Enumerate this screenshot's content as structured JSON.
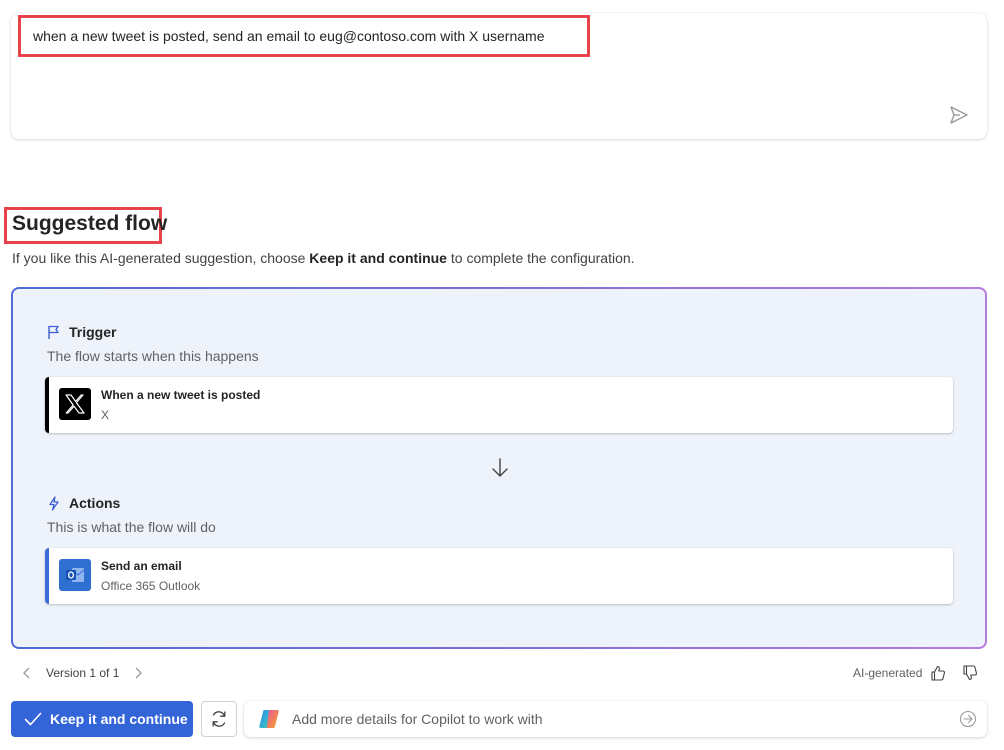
{
  "prompt": {
    "text": "when a new tweet is posted, send an email to eug@contoso.com with X username"
  },
  "header": {
    "title": "Suggested flow",
    "subtitle_pre": "If you like this AI-generated suggestion, choose ",
    "subtitle_bold": "Keep it and continue",
    "subtitle_post": " to complete the configuration."
  },
  "flow": {
    "trigger": {
      "title": "Trigger",
      "description": "The flow starts when this happens",
      "step": {
        "title": "When a new tweet is posted",
        "connector": "X",
        "accent": "#000000"
      }
    },
    "actions": {
      "title": "Actions",
      "description": "This is what the flow will do",
      "step": {
        "title": "Send an email",
        "connector": "Office 365 Outlook",
        "accent": "#3b6fd4"
      }
    }
  },
  "footer": {
    "version": "Version 1 of 1",
    "ai_generated": "AI-generated"
  },
  "actions_bar": {
    "keep_label": "Keep it and continue",
    "input_placeholder": "Add more details for Copilot to work with"
  },
  "colors": {
    "primary": "#3364d8",
    "highlight": "#e8434a",
    "flow_bg": "#eef3fb"
  },
  "icons": [
    "send-icon",
    "flag-icon",
    "x-logo-icon",
    "arrow-down-icon",
    "lightning-icon",
    "outlook-icon",
    "chevron-left-icon",
    "chevron-right-icon",
    "thumbs-up-icon",
    "thumbs-down-icon",
    "checkmark-icon",
    "refresh-icon",
    "copilot-icon",
    "arrow-right-circle-icon"
  ]
}
